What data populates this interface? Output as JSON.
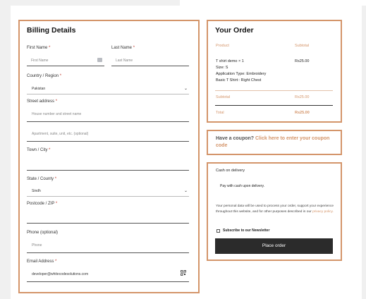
{
  "billing": {
    "title": "Billing Details",
    "first_name_label": "First Name",
    "first_name_placeholder": "First Name",
    "last_name_label": "Last Name",
    "last_name_placeholder": "Last Name",
    "country_label": "Country / Region",
    "country_value": "Pakistan",
    "street_label": "Street address",
    "street_placeholder": "House number and street name",
    "street2_placeholder": "Apartment, suite, unit, etc. (optional)",
    "town_label": "Town / City",
    "state_label": "State / County",
    "state_value": "Sindh",
    "postcode_label": "Postcode / ZIP",
    "phone_label": "Phone (optional)",
    "phone_placeholder": "Phone",
    "email_label": "Email Address",
    "email_value": "developer@whitecodesolutions.com",
    "required_mark": "*"
  },
  "order": {
    "title": "Your Order",
    "col_product": "Product",
    "col_subtotal": "Subtotal",
    "item_name": "T shirt demo  × 1",
    "item_price": "Rs25.00",
    "item_size": "Size: S",
    "item_application": "Application Type: Embroidery",
    "item_basic": "Basic T Shirt:: Right Chest",
    "subtotal_label": "Subtotal",
    "subtotal_value": "Rs25.00",
    "total_label": "Total",
    "total_value": "Rs25.00"
  },
  "coupon": {
    "prefix": "Have a coupon?",
    "link": "Click here to enter your coupon code"
  },
  "payment": {
    "method": "Cash on delivery",
    "method_desc": "Pay with cash upon delivery.",
    "privacy_text": "Your personal data will be used to process your order, support your experience throughout this website, and for other purposes described in our",
    "privacy_link": "privacy policy.",
    "newsletter_label": "Subscribe to our Newsletter",
    "place_order": "Place order"
  },
  "colors": {
    "accent": "#d4956a",
    "button": "#2b2b2b",
    "required": "#c0392b"
  }
}
